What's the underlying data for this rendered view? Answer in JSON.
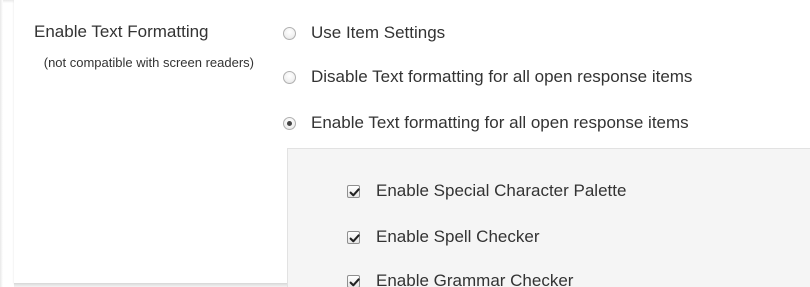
{
  "setting": {
    "label": "Enable Text Formatting",
    "note": "(not compatible with screen readers)"
  },
  "options": [
    {
      "label": "Use Item Settings",
      "checked": false
    },
    {
      "label": "Disable Text formatting for all open response items",
      "checked": false
    },
    {
      "label": "Enable Text formatting for all open response items",
      "checked": true
    }
  ],
  "features": [
    {
      "label": "Enable Special Character Palette",
      "checked": true
    },
    {
      "label": "Enable Spell Checker",
      "checked": true
    },
    {
      "label": "Enable Grammar Checker",
      "checked": true
    }
  ],
  "colors": {
    "text": "#333333",
    "panel_bg": "#f5f5f5"
  }
}
